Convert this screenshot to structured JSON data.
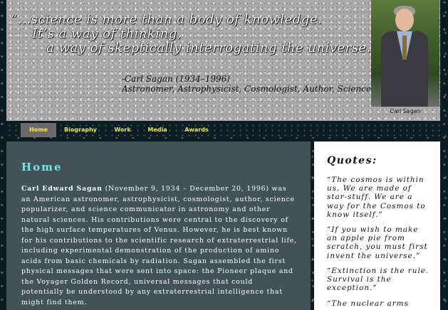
{
  "header": {
    "quote_line1": "“...science is more than a body of knowledge.",
    "quote_line2": "It’s a way of thinking,",
    "quote_line3": "a way of skeptically interrogating the universe...”",
    "attribution_name": "-Carl Sagan (1934–1996)",
    "attribution_roles": "Astronomer, Astrophysicist, Cosmologist, Author, Science Advocate",
    "photo_caption": "Carl Sagan"
  },
  "nav": {
    "items": [
      {
        "label": "Home",
        "active": true
      },
      {
        "label": "Biography",
        "active": false
      },
      {
        "label": "Work",
        "active": false
      },
      {
        "label": "Media",
        "active": false
      },
      {
        "label": "Awards",
        "active": false
      }
    ]
  },
  "main": {
    "title": "Home",
    "name_bold": "Carl Edward Sagan",
    "body": " (November 9, 1934 – December 20, 1996) was an American astronomer, astrophysicist, cosmologist, author, science popularizer, and science communicator in astronomy and other natural sciences. His contributions were central to the discovery of the high surface temperatures of Venus. However, he is best known for his contributions to the scientific research of extraterrestrial life, including experimental demonstration of the production of amino acids from basic chemicals by radiation. Sagan assembled the first physical messages that were sent into space: the Pioneer plaque and the Voyager Golden Record, universal messages that could potentially be understood by any extraterrestrial intelligence that might find them."
  },
  "sidebar": {
    "title": "Quotes:",
    "quotes": [
      "“The cosmos is within us. We are made of star-stuff. We are a way for the Cosmos to know itself.”",
      "“If you wish to make an apple pie from scratch, you must first invent the universe.”",
      "“Extinction is the rule. Survival is the exception.”",
      "“The nuclear arms race"
    ]
  },
  "colors": {
    "background": "#0c1a22",
    "header_bg": "#a9a9a9",
    "nav_text": "#e7e84c",
    "main_bg": "#415359",
    "main_title": "#6fe6e8",
    "quotes_bg": "#ffffff"
  }
}
